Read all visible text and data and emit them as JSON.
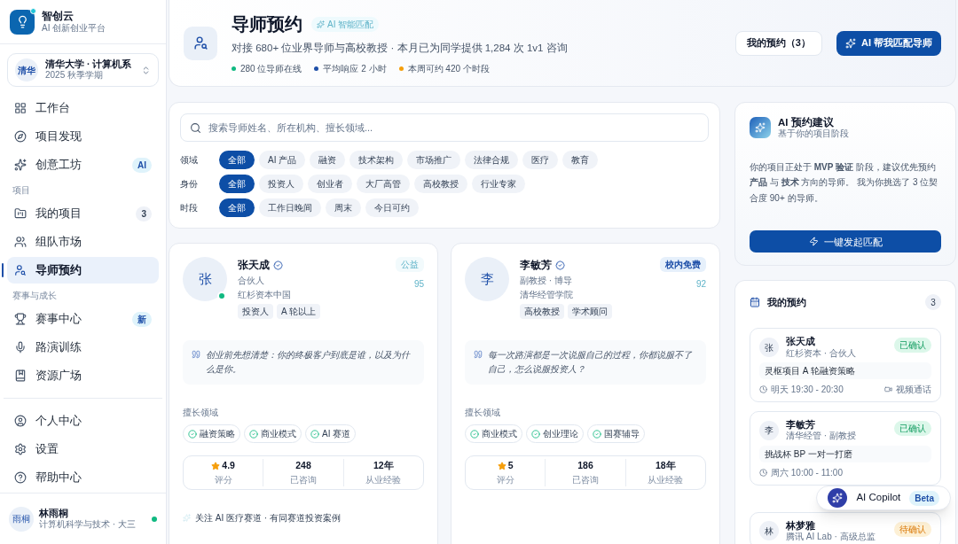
{
  "brand": {
    "name": "智创云",
    "tagline": "AI 创新创业平台"
  },
  "org": {
    "badge": "清华",
    "name": "清华大学 · 计算机系",
    "term": "2025 秋季学期"
  },
  "nav_groups": [
    {
      "items": [
        {
          "label": "工作台",
          "selected": false
        },
        {
          "label": "项目发现",
          "selected": false
        },
        {
          "label": "创意工坊",
          "selected": false,
          "badge": {
            "text": "AI",
            "kind": "accent"
          }
        }
      ]
    },
    {
      "heading": "项目",
      "items": [
        {
          "label": "我的项目",
          "selected": false,
          "badge": {
            "text": "3",
            "kind": "neutral"
          }
        },
        {
          "label": "组队市场",
          "selected": false
        },
        {
          "label": "导师预约",
          "selected": true
        }
      ]
    },
    {
      "heading": "赛事与成长",
      "items": [
        {
          "label": "赛事中心",
          "selected": false,
          "badge": {
            "text": "新",
            "kind": "accent"
          }
        },
        {
          "label": "路演训练",
          "selected": false
        },
        {
          "label": "资源广场",
          "selected": false
        }
      ]
    }
  ],
  "footer_nav": [
    {
      "label": "个人中心",
      "selected": false
    },
    {
      "label": "设置",
      "selected": false
    },
    {
      "label": "帮助中心",
      "selected": false
    }
  ],
  "user": {
    "avatar": "雨桐",
    "name": "林雨桐",
    "detail": "计算机科学与技术 · 大三",
    "online": true
  },
  "header": {
    "title": "导师预约",
    "tag": "AI 智能匹配",
    "subtitle": "对接 680+ 位业界导师与高校教授 · 本月已为同学提供 1,284 次 1v1 咨询",
    "stats": [
      {
        "text": "280 位导师在线",
        "color": "#10b981"
      },
      {
        "text": "平均响应 2 小时",
        "color": "#1e4fa8"
      },
      {
        "text": "本周可约 420 个时段",
        "color": "#f59e0b"
      }
    ],
    "my_bookings_button": "我的预约（3）",
    "match_button": "AI 帮我匹配导师"
  },
  "filters": {
    "search": {
      "placeholder": "搜索导师姓名、所在机构、擅长领域..."
    },
    "rows": [
      {
        "label": "领域",
        "chips": [
          {
            "label": "全部",
            "selected": true
          },
          {
            "label": "AI 产品",
            "selected": false
          },
          {
            "label": "融资",
            "selected": false
          },
          {
            "label": "技术架构",
            "selected": false
          },
          {
            "label": "市场推广",
            "selected": false
          },
          {
            "label": "法律合规",
            "selected": false
          },
          {
            "label": "医疗",
            "selected": false
          },
          {
            "label": "教育",
            "selected": false
          }
        ]
      },
      {
        "label": "身份",
        "chips": [
          {
            "label": "全部",
            "selected": true
          },
          {
            "label": "投资人",
            "selected": false
          },
          {
            "label": "创业者",
            "selected": false
          },
          {
            "label": "大厂高管",
            "selected": false
          },
          {
            "label": "高校教授",
            "selected": false
          },
          {
            "label": "行业专家",
            "selected": false
          }
        ]
      },
      {
        "label": "时段",
        "chips": [
          {
            "label": "全部",
            "selected": true
          },
          {
            "label": "工作日晚间",
            "selected": false
          },
          {
            "label": "周末",
            "selected": false
          },
          {
            "label": "今日可约",
            "selected": false
          }
        ]
      }
    ]
  },
  "mentors": [
    {
      "avatar": "张",
      "name": "张天成",
      "verified": true,
      "online": true,
      "title": "合伙人",
      "org": "红杉资本中国",
      "tags": [
        "投资人",
        "A 轮以上"
      ],
      "badge": "公益",
      "badge_highlighted": false,
      "score": "95",
      "quote": "创业前先想清楚：你的终极客户到底是谁，以及为什么是你。",
      "expertise_label": "擅长领域",
      "expertise": [
        "融资策略",
        "商业模式",
        "AI 赛道"
      ],
      "stats": [
        {
          "kind": "rating",
          "value": "4.9",
          "label": "评分"
        },
        {
          "kind": "number",
          "value": "248",
          "label": "已咨询"
        },
        {
          "kind": "number",
          "value": "12年",
          "label": "从业经验"
        }
      ],
      "note": "关注 AI 医疗赛道 · 有同赛道投资案例"
    },
    {
      "avatar": "李",
      "name": "李敏芳",
      "verified": true,
      "online": false,
      "title": "副教授 · 博导",
      "org": "清华经管学院",
      "tags": [
        "高校教授",
        "学术顾问"
      ],
      "badge": "校内免费",
      "badge_highlighted": true,
      "score": "92",
      "quote": "每一次路演都是一次说服自己的过程，你都说服不了自己，怎么说服投资人？",
      "expertise_label": "擅长领域",
      "expertise": [
        "商业模式",
        "创业理论",
        "国赛辅导"
      ],
      "stats": [
        {
          "kind": "rating",
          "value": "5",
          "label": "评分"
        },
        {
          "kind": "number",
          "value": "186",
          "label": "已咨询"
        },
        {
          "kind": "number",
          "value": "18年",
          "label": "从业经验"
        }
      ]
    }
  ],
  "ai_advice": {
    "title": "AI 预约建议",
    "subtitle": "基于你的项目阶段",
    "text": "你的项目正处于 **MVP 验证** 阶段，建议优先预约**产品** 与 **技术** 方向的导师。 我为你挑选了 3 位契合度 90+ 的导师。",
    "button": "一键发起匹配"
  },
  "bookings": {
    "title": "我的预约",
    "count": "3",
    "items": [
      {
        "avatar": "张",
        "name": "张天成",
        "org": "红杉资本 · 合伙人",
        "status": {
          "text": "已确认",
          "kind": "confirmed"
        },
        "topic": "灵枢项目 A 轮融资策略",
        "time": "明天 19:30 - 20:30",
        "mode": "视频通话"
      },
      {
        "avatar": "李",
        "name": "李敏芳",
        "org": "清华经管 · 副教授",
        "status": {
          "text": "已确认",
          "kind": "confirmed"
        },
        "topic": "挑战杯 BP 一对一打磨",
        "time": "周六 10:00 - 11:00"
      },
      {
        "avatar": "林",
        "name": "林梦雅",
        "org": "腾讯 AI Lab · 高级总监",
        "status": {
          "text": "待确认",
          "kind": "pending"
        }
      }
    ]
  },
  "copilot": {
    "label": "AI Copilot",
    "badge": "Beta"
  }
}
